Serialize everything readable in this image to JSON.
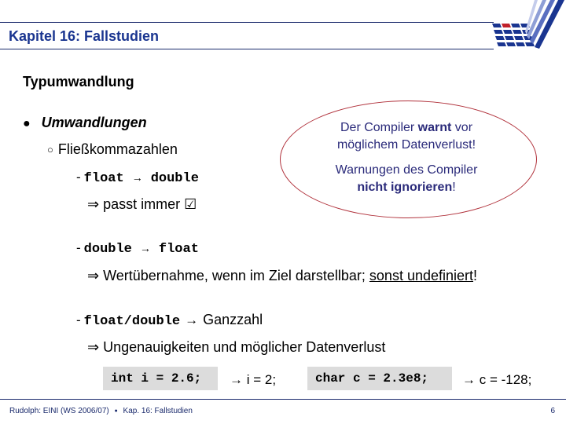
{
  "header": {
    "title": "Kapitel 16: Fallstudien",
    "logo": "university-logo-icon",
    "colors": {
      "brand_blue": "#1a3590",
      "logo_red": "#c0202a",
      "rule": "#1a2a6c"
    }
  },
  "slide": {
    "section_title": "Typumwandlung",
    "bullet": {
      "marker": "●",
      "label": "Umwandlungen"
    },
    "sub_bullet": {
      "marker": "○",
      "label": "Fließkommazahlen"
    },
    "items": [
      {
        "dash": "-",
        "from": "float",
        "arrow": "→",
        "to": "double",
        "implication_symbol": "⇒",
        "implication_text": "passt immer",
        "checkbox": "☑"
      },
      {
        "dash": "-",
        "from": "double",
        "arrow": "→",
        "to": "float",
        "implication_symbol": "⇒",
        "implication_text_pre": "Wertübernahme, wenn im Ziel darstellbar; ",
        "implication_text_underlined": "sonst undefiniert",
        "implication_text_post": "!"
      },
      {
        "dash": "-",
        "from": "float/double",
        "arrow": "→",
        "to": "Ganzzahl",
        "implication_symbol": "⇒",
        "implication_text": "Ungenauigkeiten und möglicher Datenverlust"
      }
    ],
    "examples": [
      {
        "code": "int i = 2.6;",
        "result": "→ i = 2;"
      },
      {
        "code": "char c = 2.3e8;",
        "result": "→ c = -128;"
      }
    ],
    "callout": {
      "line1_pre": "Der Compiler ",
      "line1_bold": "warnt",
      "line1_post": " vor",
      "line2": "möglichem Datenverlust!",
      "line3": "Warnungen des Compiler",
      "line4_bold": "nicht ignorieren",
      "line4_post": "!",
      "border_color": "#b0303a",
      "text_color": "#2a2a7a"
    }
  },
  "footer": {
    "left_text": "Rudolph: EINI (WS 2006/07)",
    "separator": "●",
    "chapter": "Kap. 16: Fallstudien",
    "page_number": "6"
  }
}
